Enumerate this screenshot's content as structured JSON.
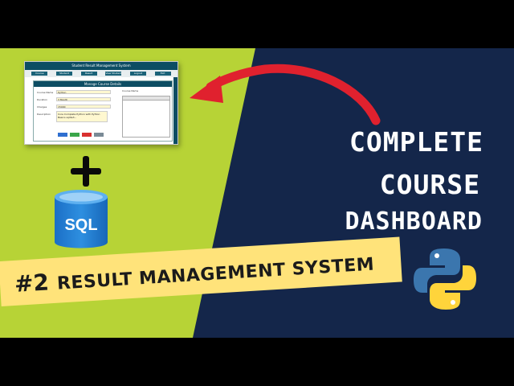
{
  "thumbnail": {
    "headline": {
      "line1": "COMPLETE",
      "line2": "COURSE",
      "line3": "DASHBOARD"
    },
    "banner": {
      "number": "#2",
      "text": "RESULT MANAGEMENT SYSTEM"
    },
    "sql_icon_label": "SQL",
    "colors": {
      "green": "#b7d336",
      "navy": "#14264a",
      "banner": "#ffe37a",
      "arrow": "#e0212e"
    }
  },
  "mini_screenshot": {
    "title": "Student Result Management System",
    "nav": [
      "Course",
      "Student",
      "Result",
      "View Student Results",
      "Logout",
      "Exit"
    ],
    "window_title": "Manage Course Details",
    "fields": [
      {
        "label": "Course Name",
        "value": "Python"
      },
      {
        "label": "Duration",
        "value": "3 Month"
      },
      {
        "label": "Charges",
        "value": "15000"
      }
    ],
    "description_label": "Description",
    "description_value": "Core Complete Python with Python Basics sqlite3...",
    "search_label": "Course Name"
  }
}
